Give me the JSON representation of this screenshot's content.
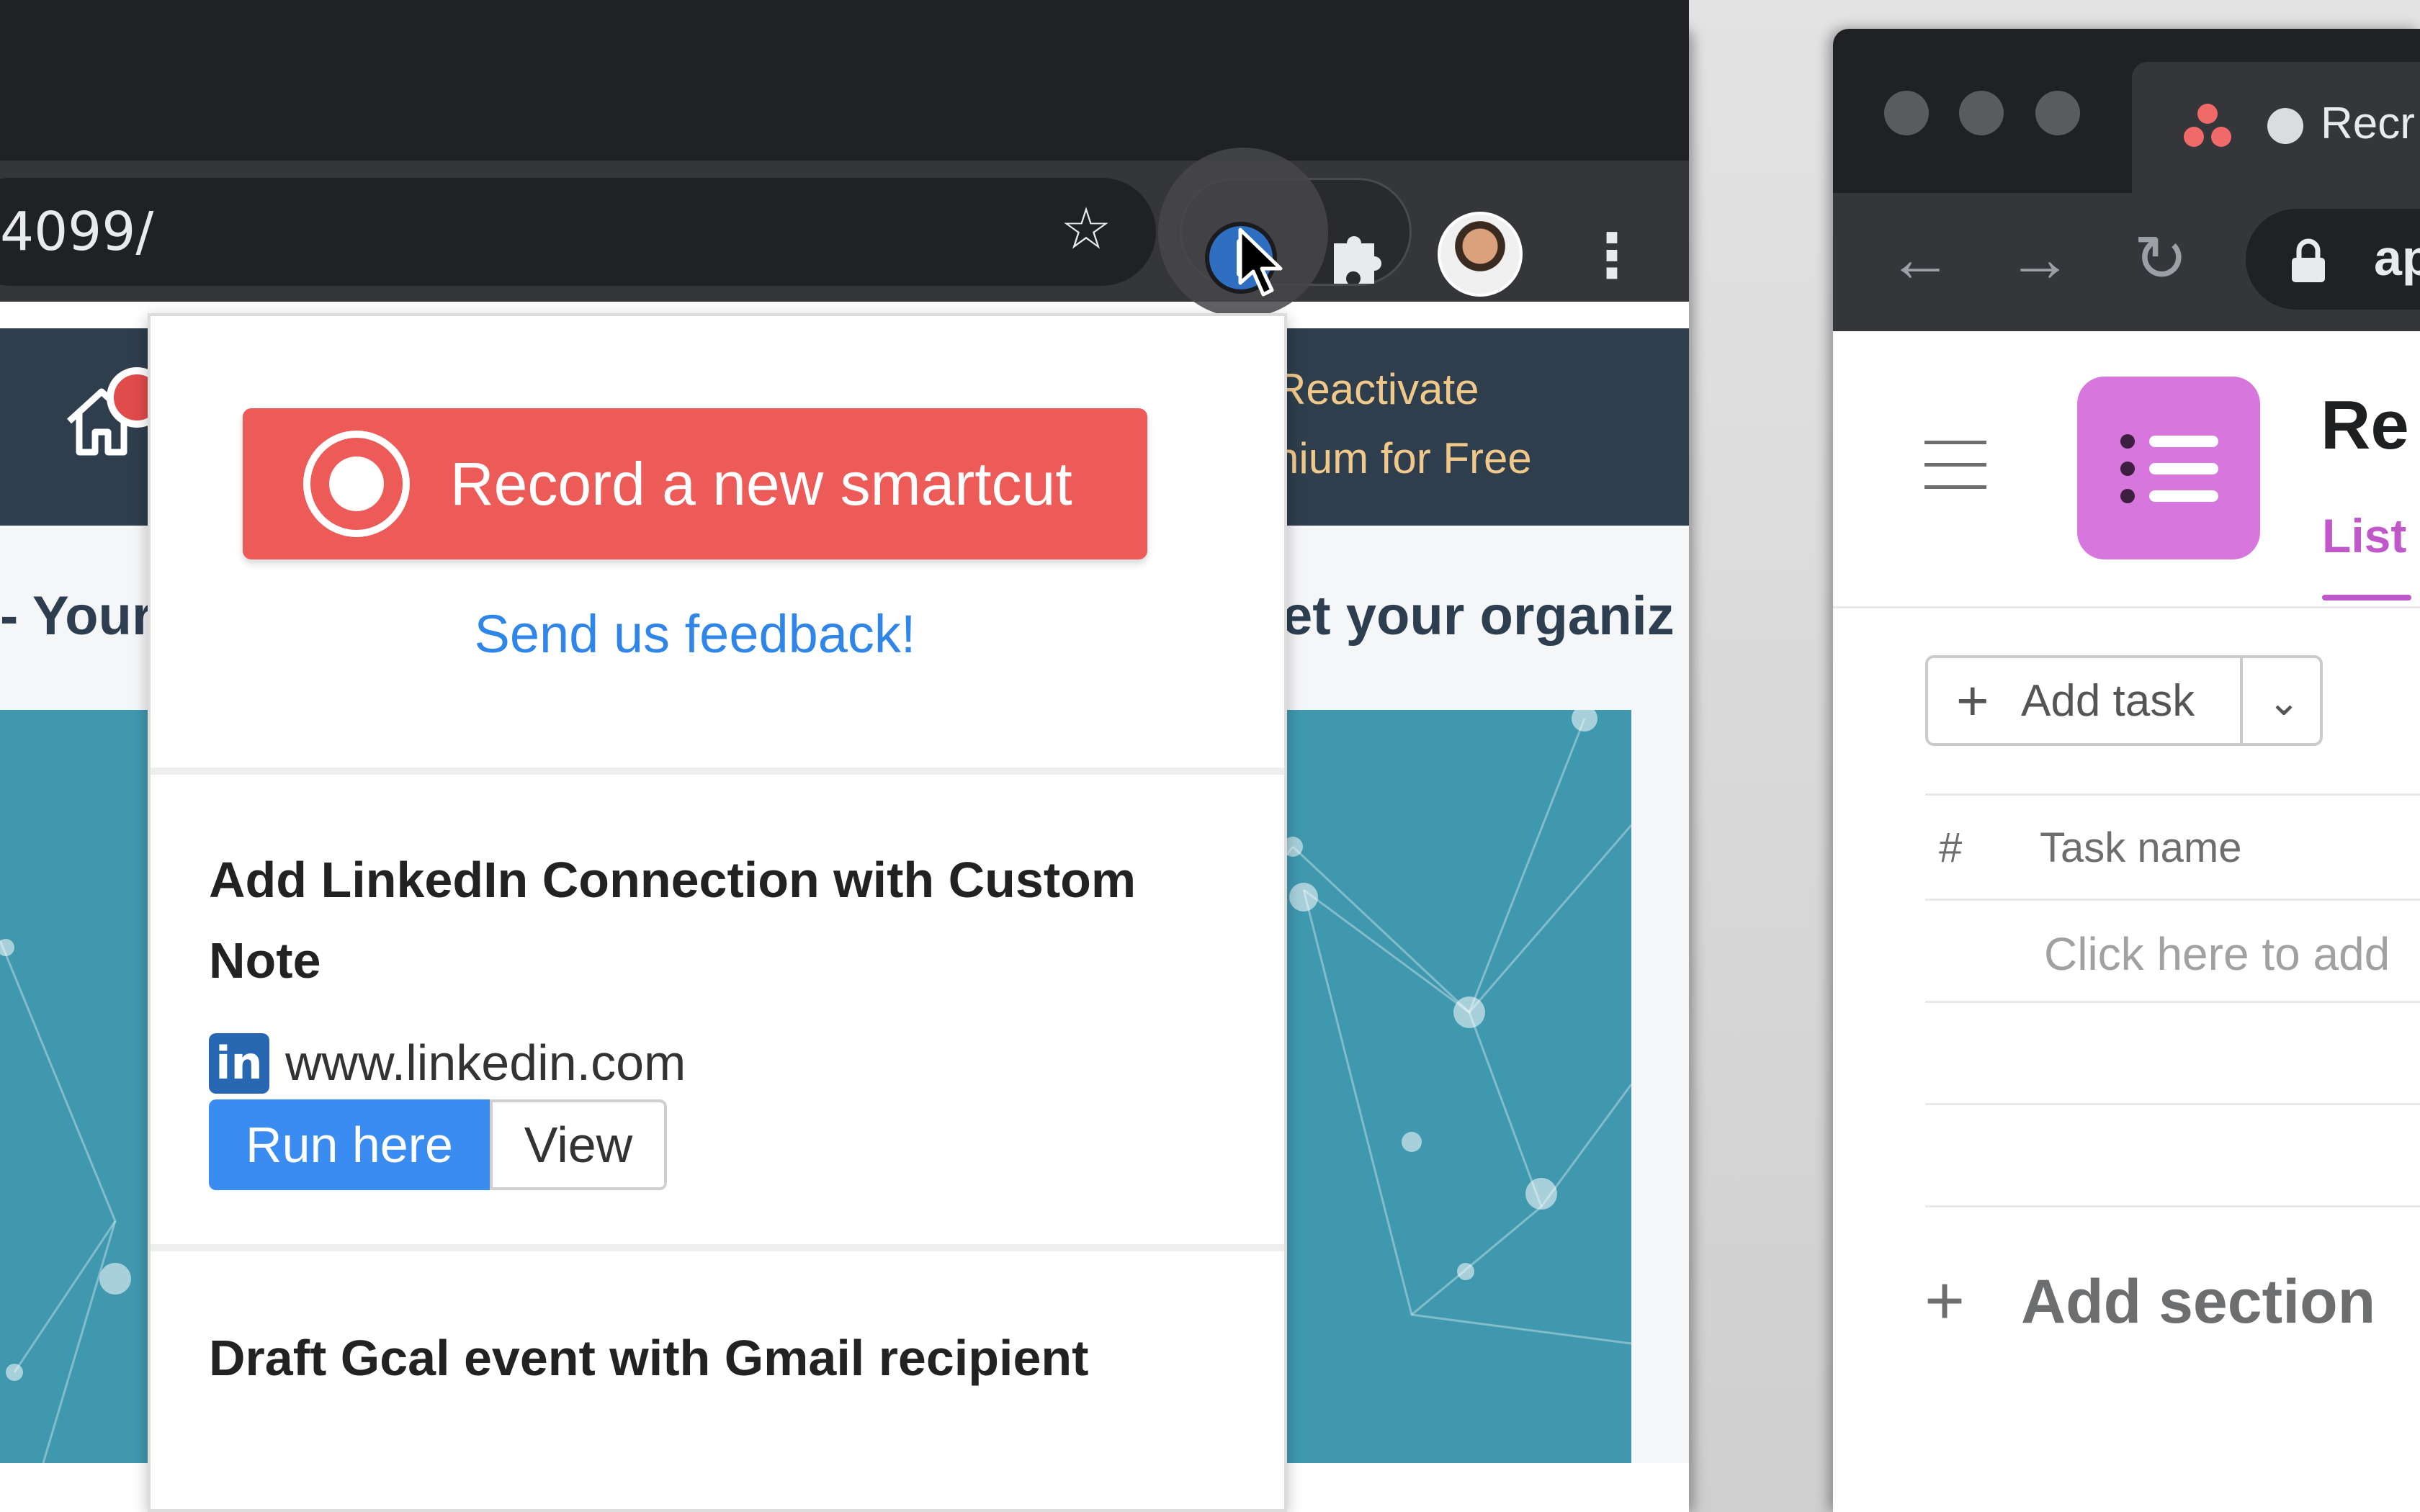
{
  "left_browser": {
    "url_fragment": "4099/",
    "icons": {
      "bookmark": "star-icon",
      "extension": "smartcut-extension-icon",
      "extensions_menu": "puzzle-icon",
      "profile": "avatar",
      "menu": "kebab-menu-icon"
    },
    "page": {
      "banner_line_1": "Reactivate",
      "banner_line_2": "nium for Free",
      "heading_left": "- Your",
      "heading_right": "et your organiz"
    }
  },
  "popup": {
    "record_button": "Record a new smartcut",
    "feedback_link": "Send us feedback!",
    "smartcuts": [
      {
        "title": "Add LinkedIn Connection with Custom Note",
        "domain": "www.linkedin.com",
        "domain_icon": "linkedin-icon",
        "domain_icon_text": "in",
        "run_label": "Run here",
        "view_label": "View"
      },
      {
        "title": "Draft Gcal event with Gmail recipient"
      }
    ]
  },
  "right_browser": {
    "tab_title": "Recr",
    "url_fragment": "ap",
    "project": {
      "title": "Re",
      "active_tab": "List",
      "add_task_label": "Add task",
      "columns": [
        "#",
        "Task name"
      ],
      "new_task_placeholder": "Click here to add",
      "add_section_label": "Add section"
    }
  },
  "colors": {
    "record_button": "#ec5b58",
    "link_blue": "#2f86e8",
    "run_button": "#3b8cf0",
    "asana_accent": "#c158c9",
    "project_icon": "#d776dd",
    "hero_teal": "#3f98ae",
    "page_header": "#2f3e4c"
  }
}
